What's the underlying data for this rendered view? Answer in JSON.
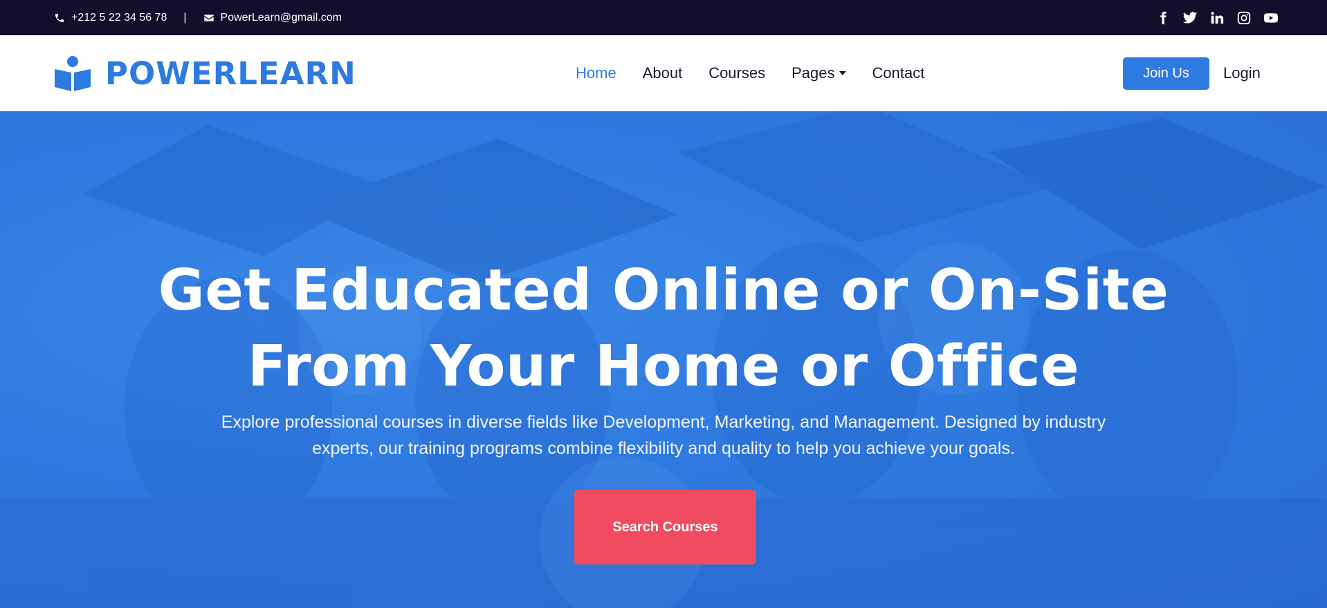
{
  "topbar": {
    "phone": "+212 5 22 34 56 78",
    "separator": "|",
    "email": "PowerLearn@gmail.com",
    "socials": [
      "facebook-icon",
      "twitter-icon",
      "linkedin-icon",
      "instagram-icon",
      "youtube-icon"
    ]
  },
  "brand": {
    "name": "POWERLEARN",
    "icon": "reader-book-icon",
    "color": "#2d7be0"
  },
  "nav": {
    "items": [
      {
        "label": "Home",
        "active": true
      },
      {
        "label": "About",
        "active": false
      },
      {
        "label": "Courses",
        "active": false
      },
      {
        "label": "Pages",
        "active": false
      },
      {
        "label": "Contact",
        "active": false
      }
    ],
    "join_label": "Join Us",
    "login_label": "Login"
  },
  "hero": {
    "title_line1": "Get Educated Online or On-Site",
    "title_line2": "From Your Home or Office",
    "subtitle_line1": "Explore professional courses in diverse fields like Development, Marketing, and Management. Designed by industry",
    "subtitle_line2": "experts, our training programs combine flexibility and quality to help you achieve your goals.",
    "cta_label": "Search Courses",
    "cta_color": "#f04b5e",
    "overlay_color": "#2f7ae0"
  },
  "colors": {
    "topbar_bg": "#120f2d",
    "accent": "#2d7be0",
    "nav_text": "#141a2e"
  }
}
